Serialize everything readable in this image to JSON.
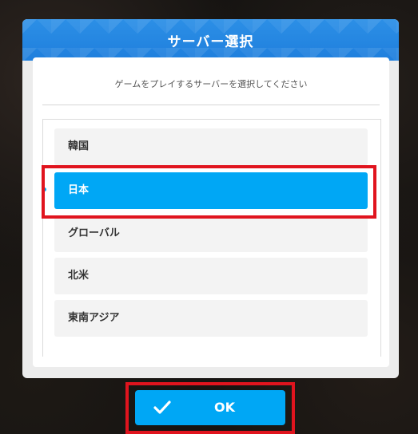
{
  "dialog": {
    "title": "サーバー選択",
    "subtitle": "ゲームをプレイするサーバーを選択してください"
  },
  "servers": [
    {
      "label": "韓国",
      "selected": false
    },
    {
      "label": "日本",
      "selected": true
    },
    {
      "label": "グローバル",
      "selected": false
    },
    {
      "label": "北米",
      "selected": false
    },
    {
      "label": "東南アジア",
      "selected": false
    }
  ],
  "ok_button": {
    "label": "OK",
    "icon": "check-icon"
  },
  "colors": {
    "header": "#1f7fdd",
    "accent": "#00a7f5",
    "highlight": "#e0141e"
  }
}
